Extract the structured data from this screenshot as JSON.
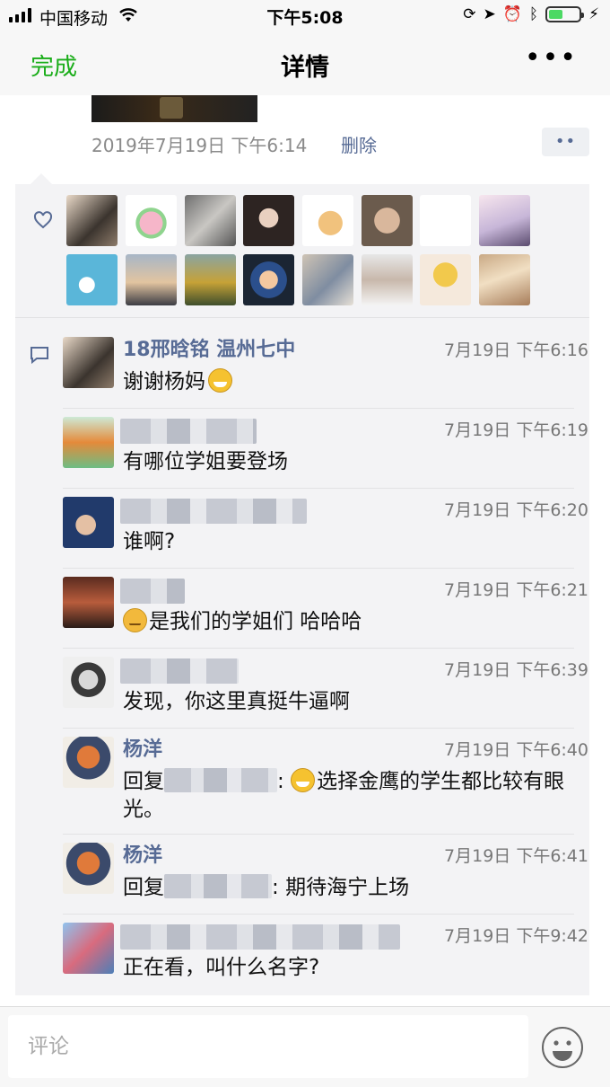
{
  "status_bar": {
    "carrier": "中国移动",
    "time": "下午5:08",
    "battery_level": 0.42
  },
  "nav": {
    "done": "完成",
    "title": "详情",
    "more": "•••"
  },
  "moment": {
    "date": "2019年7月19日 下午6:14",
    "delete": "删除",
    "more": "••"
  },
  "comment_input": {
    "placeholder": "评论"
  },
  "comments": [
    {
      "name": "18邢晗铭 温州七中",
      "time": "7月19日 下午6:16",
      "text": "谢谢杨妈"
    },
    {
      "name": "",
      "time": "7月19日 下午6:19",
      "text": "有哪位学姐要登场"
    },
    {
      "name": "",
      "time": "7月19日 下午6:20",
      "text": "谁啊?"
    },
    {
      "name": "",
      "time": "7月19日 下午6:21",
      "text": "是我们的学姐们 哈哈哈"
    },
    {
      "name": "",
      "time": "7月19日 下午6:39",
      "text": "发现，你这里真挺牛逼啊"
    },
    {
      "name": "杨洋",
      "time": "7月19日 下午6:40",
      "reply_prefix": "回复",
      "colon": ":",
      "text": "选择金鹰的学生都比较有眼光。"
    },
    {
      "name": "杨洋",
      "time": "7月19日 下午6:41",
      "reply_prefix": "回复",
      "colon": ":",
      "text": "期待海宁上场"
    },
    {
      "name": "",
      "time": "7月19日 下午9:42",
      "text": "正在看，叫什么名字?"
    }
  ]
}
